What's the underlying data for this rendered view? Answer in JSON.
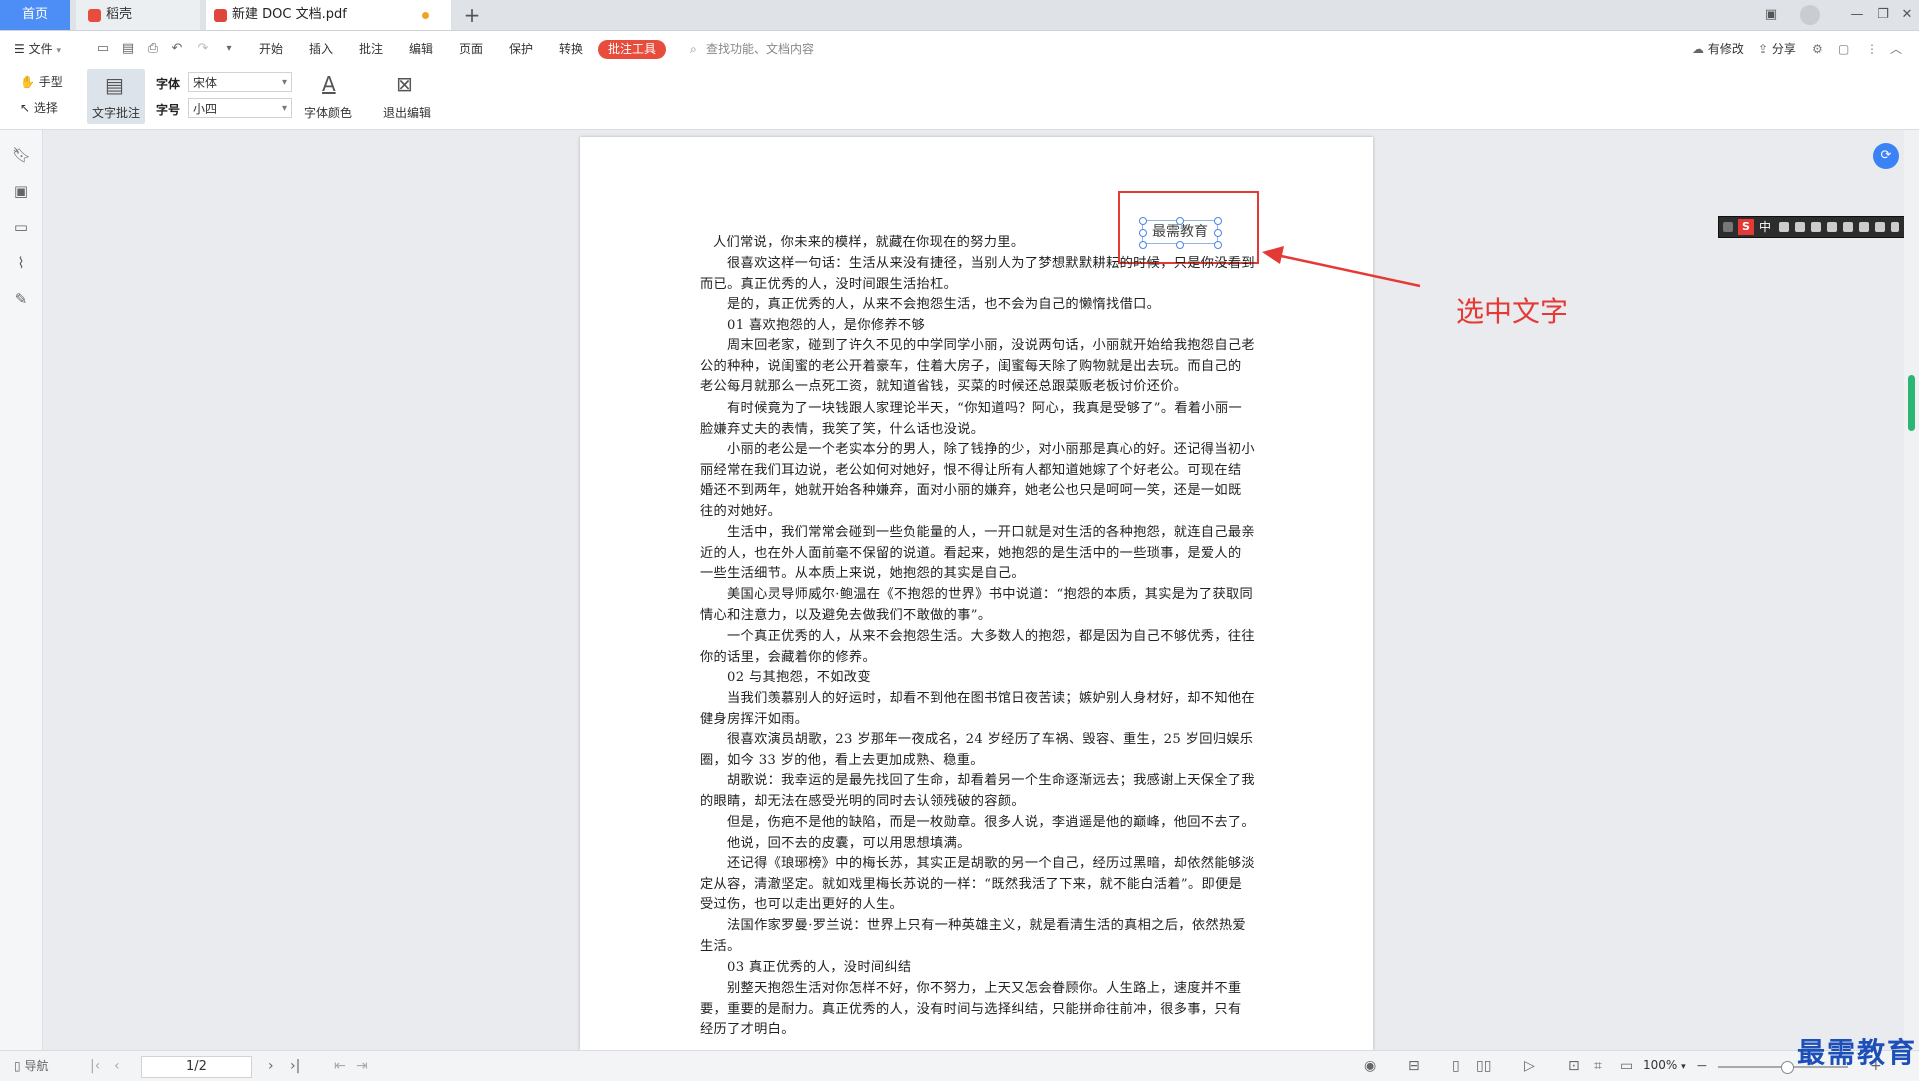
{
  "tabs": {
    "home": "首页",
    "shell": "稻壳",
    "document": "新建 DOC 文档.pdf",
    "new_tab": "+"
  },
  "menu": {
    "file": "文件",
    "items": [
      "开始",
      "插入",
      "批注",
      "编辑",
      "页面",
      "保护",
      "转换"
    ],
    "active_tool": "批注工具",
    "search_placeholder": "查找功能、文档内容",
    "has_changes": "有修改",
    "share": "分享"
  },
  "ribbon": {
    "hand": "手型",
    "select": "选择",
    "text_note": "文字批注",
    "font_label": "字体",
    "font_value": "宋体",
    "size_label": "字号",
    "size_value": "小四",
    "font_color": "字体颜色",
    "exit_edit": "退出编辑"
  },
  "document": {
    "selected_text": "最需教育",
    "paragraphs": [
      "人们常说，你未来的模样，就藏在你现在的努力里。",
      "很喜欢这样一句话：生活从来没有捷径，当别人为了梦想默默耕耘的时候，只是你没看到而已。真正优秀的人，没时间跟生活抬杠。",
      "是的，真正优秀的人，从来不会抱怨生活，也不会为自己的懒惰找借口。",
      "01 喜欢抱怨的人，是你修养不够",
      "周末回老家，碰到了许久不见的中学同学小丽，没说两句话，小丽就开始给我抱怨自己老公的种种，说闺蜜的老公开着豪车，住着大房子，闺蜜每天除了购物就是出去玩。而自己的老公每月就那么一点死工资，就知道省钱，买菜的时候还总跟菜贩老板讨价还价。",
      "有时候竟为了一块钱跟人家理论半天，“你知道吗？阿心，我真是受够了”。看着小丽一脸嫌弃丈夫的表情，我笑了笑，什么话也没说。",
      "小丽的老公是一个老实本分的男人，除了钱挣的少，对小丽那是真心的好。还记得当初小丽经常在我们耳边说，老公如何对她好，恨不得让所有人都知道她嫁了个好老公。可现在结婚还不到两年，她就开始各种嫌弃，面对小丽的嫌弃，她老公也只是呵呵一笑，还是一如既往的对她好。",
      "生活中，我们常常会碰到一些负能量的人，一开口就是对生活的各种抱怨，就连自己最亲近的人，也在外人面前毫不保留的说道。看起来，她抱怨的是生活中的一些琐事，是爱人的一些生活细节。从本质上来说，她抱怨的其实是自己。",
      "美国心灵导师威尔·鲍温在《不抱怨的世界》书中说道：“抱怨的本质，其实是为了获取同情心和注意力，以及避免去做我们不敢做的事”。",
      "一个真正优秀的人，从来不会抱怨生活。大多数人的抱怨，都是因为自己不够优秀，往往你的话里，会藏着你的修养。",
      "02 与其抱怨，不如改变",
      "当我们羡慕别人的好运时，却看不到他在图书馆日夜苦读；嫉妒别人身材好，却不知他在健身房挥汗如雨。",
      "很喜欢演员胡歌，23 岁那年一夜成名，24 岁经历了车祸、毁容、重生，25 岁回归娱乐圈，如今 33 岁的他，看上去更加成熟、稳重。",
      "胡歌说：我幸运的是最先找回了生命，却看着另一个生命逐渐远去；我感谢上天保全了我的眼睛，却无法在感受光明的同时去认领残破的容颜。",
      "但是，伤疤不是他的缺陷，而是一枚勋章。很多人说，李逍遥是他的巅峰，他回不去了。",
      "他说，回不去的皮囊，可以用思想填满。",
      "还记得《琅琊榜》中的梅长苏，其实正是胡歌的另一个自己，经历过黑暗，却依然能够淡定从容，清澈坚定。就如戏里梅长苏说的一样：“既然我活了下来，就不能白活着”。即便是受过伤，也可以走出更好的人生。",
      "法国作家罗曼·罗兰说：世界上只有一种英雄主义，就是看清生活的真相之后，依然热爱生活。",
      "03 真正优秀的人，没时间纠结",
      "别整天抱怨生活对你怎样不好，你不努力，上天又怎会眷顾你。人生路上，速度并不重要，重要的是耐力。真正优秀的人，没有时间与选择纠结，只能拼命往前冲，很多事，只有经历了才明白。"
    ]
  },
  "annotation": {
    "hint": "选中文字"
  },
  "ime": {
    "mode": "中"
  },
  "status": {
    "nav": "导航",
    "page": "1/2",
    "zoom": "100%"
  },
  "watermark": "最需教育",
  "colors": {
    "accent_red": "#e53935",
    "home_tab": "#4c8df6",
    "scroll_thumb": "#2bb673"
  }
}
